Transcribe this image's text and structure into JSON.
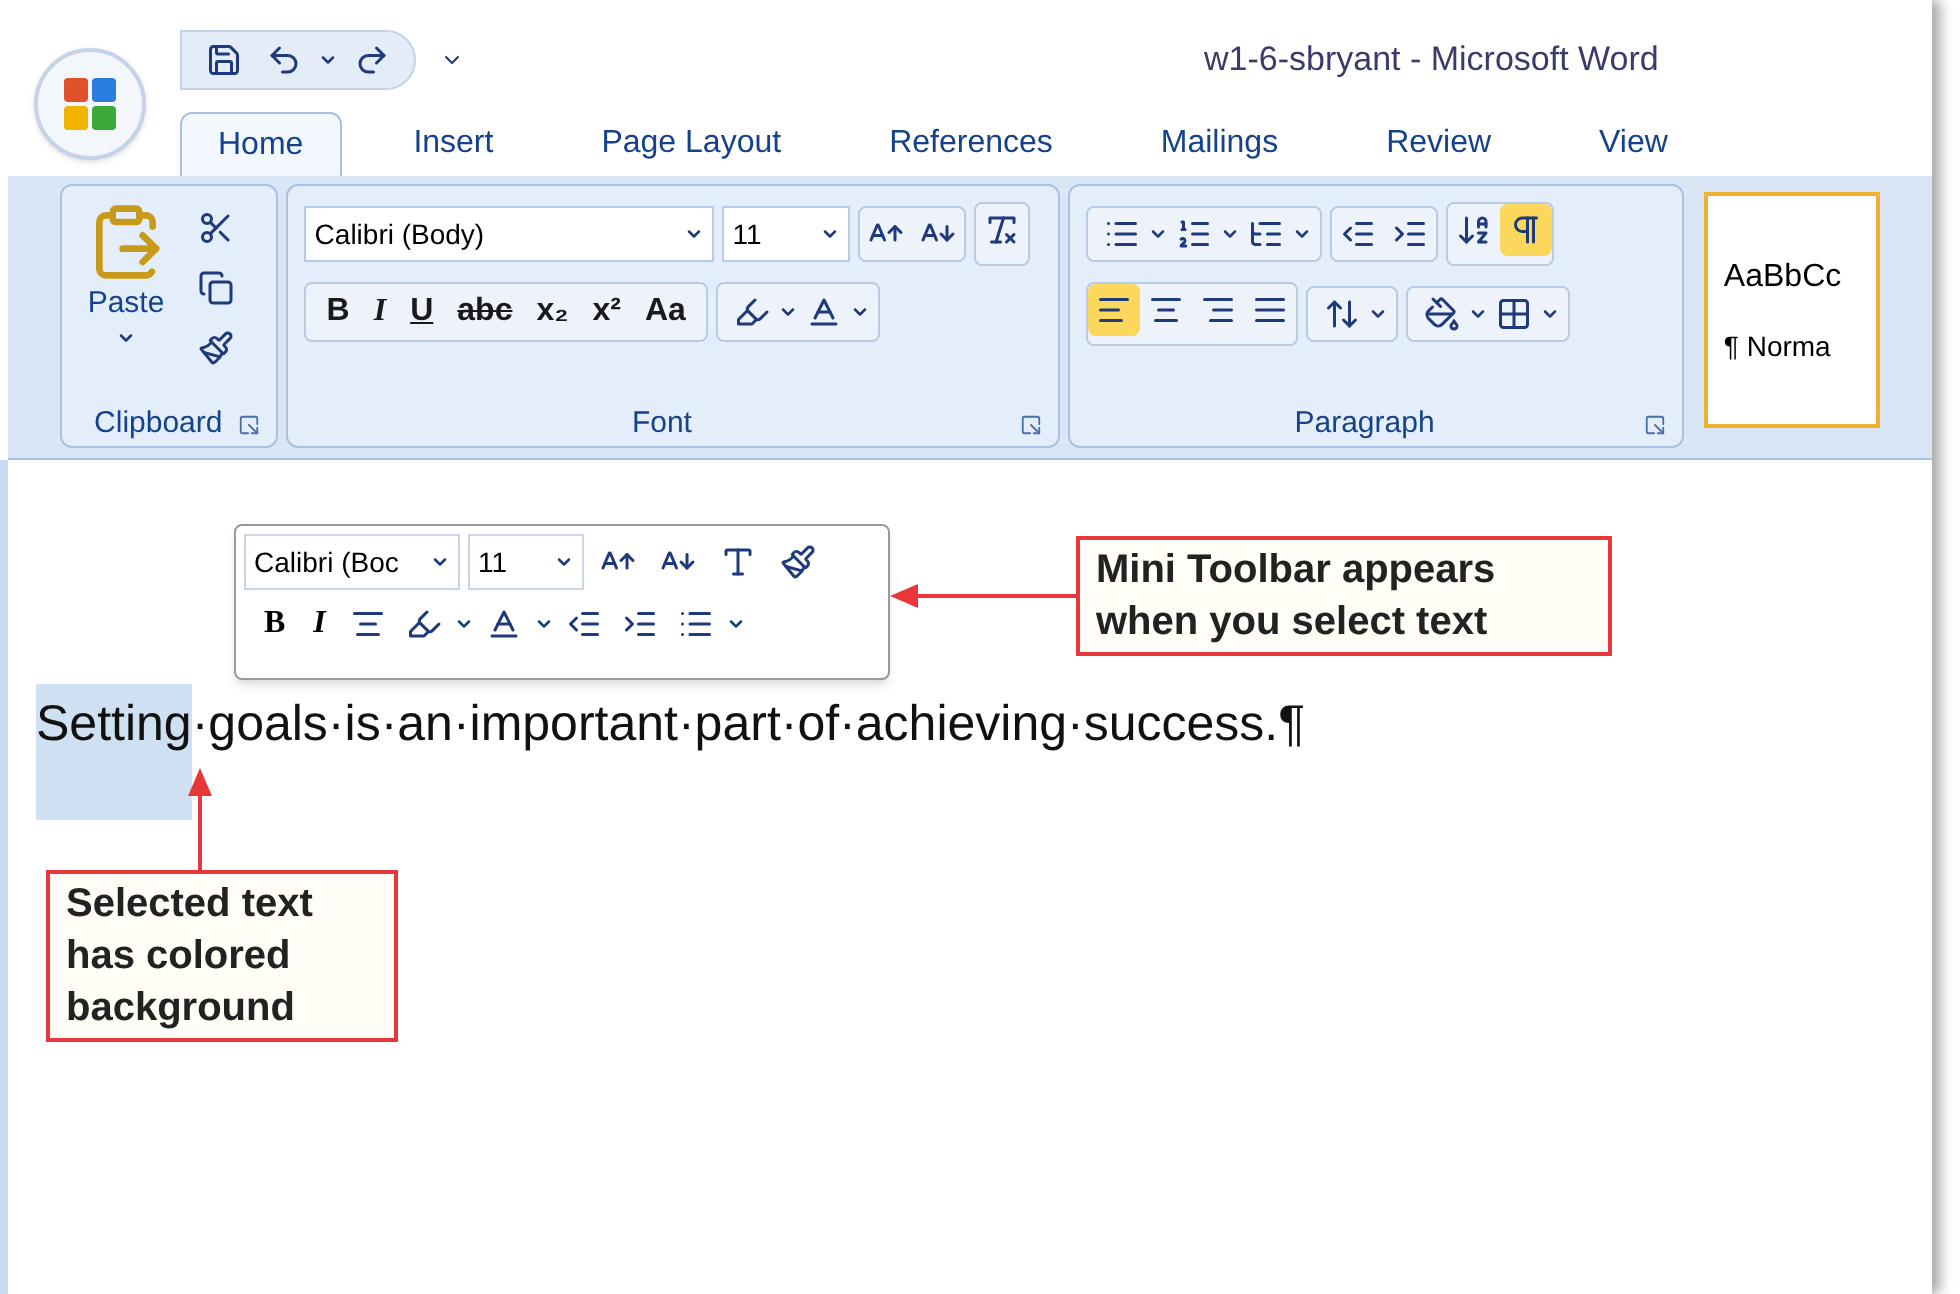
{
  "window": {
    "title": "w1-6-sbryant - Microsoft Word"
  },
  "tabs": [
    {
      "label": "Home",
      "selected": true
    },
    {
      "label": "Insert",
      "selected": false
    },
    {
      "label": "Page Layout",
      "selected": false
    },
    {
      "label": "References",
      "selected": false
    },
    {
      "label": "Mailings",
      "selected": false
    },
    {
      "label": "Review",
      "selected": false
    },
    {
      "label": "View",
      "selected": false
    }
  ],
  "clipboard": {
    "label": "Clipboard",
    "paste_label": "Paste"
  },
  "font": {
    "label": "Font",
    "font_name": "Calibri (Body)",
    "font_size": "11",
    "format_buttons": [
      "B",
      "I",
      "U",
      "abc",
      "x₂",
      "x²",
      "Aa"
    ]
  },
  "paragraph": {
    "label": "Paragraph",
    "show_marks": true,
    "alignments": [
      {
        "kind": "left",
        "selected": true
      },
      {
        "kind": "center",
        "selected": false
      },
      {
        "kind": "right",
        "selected": false
      },
      {
        "kind": "justify",
        "selected": false
      }
    ]
  },
  "styles": {
    "preview": "AaBbCc",
    "name": "¶ Norma"
  },
  "mini_toolbar": {
    "font_name": "Calibri (Boc",
    "font_size": "11",
    "bold": "B",
    "italic": "I"
  },
  "document": {
    "segments": [
      {
        "text": "Setting",
        "selected": true
      },
      {
        "text": "·goals·is·an·important·part·of·achieving·success.¶",
        "selected": false
      }
    ]
  },
  "callouts": [
    {
      "text": "Mini Toolbar appears when you select text"
    },
    {
      "text": "Selected text has colored background"
    }
  ]
}
